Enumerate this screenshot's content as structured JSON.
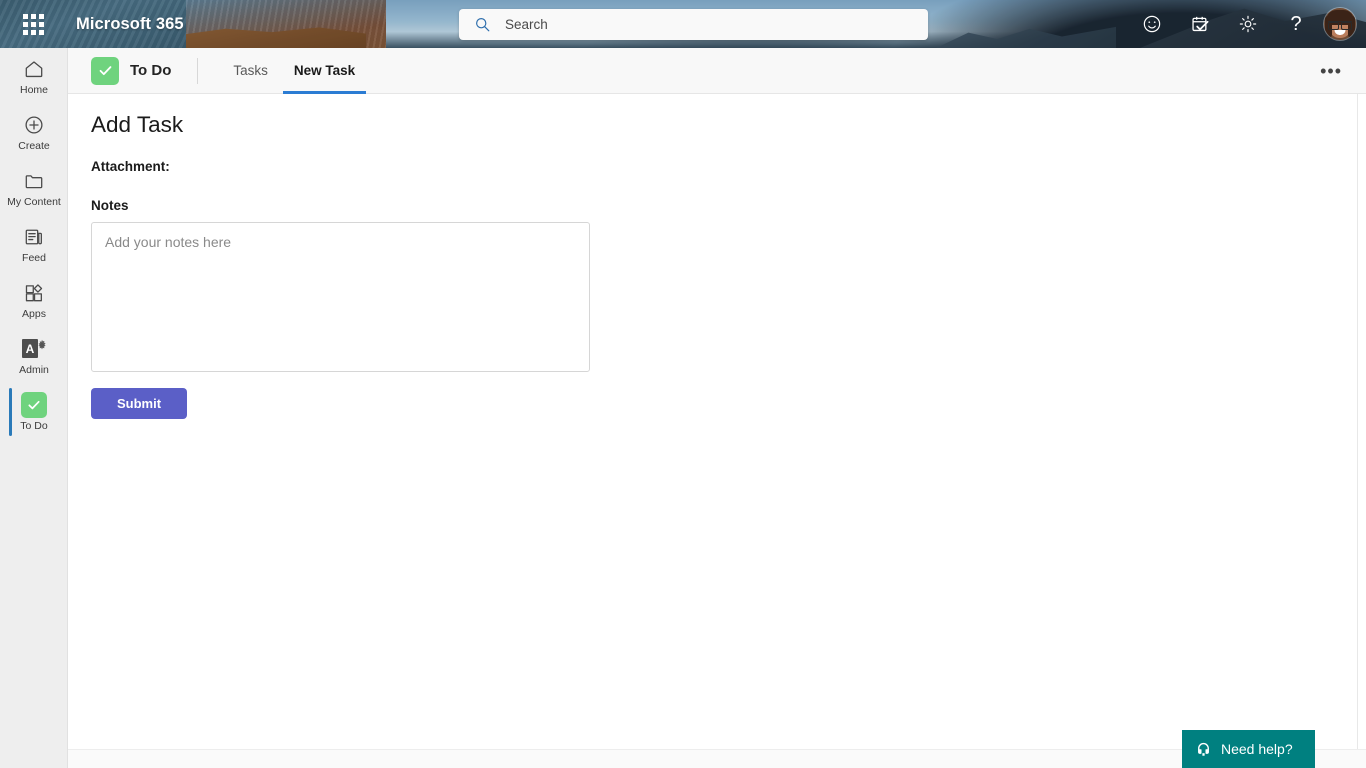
{
  "suite_header": {
    "waffle_icon": "app-launcher-grid-icon",
    "brand": "Microsoft 365",
    "search": {
      "placeholder": "Search",
      "value": "",
      "icon": "search-icon"
    },
    "actions": [
      {
        "name": "feedback-smiley-icon",
        "tooltip": "Feedback"
      },
      {
        "name": "calendar-check-icon",
        "tooltip": "Tasks"
      },
      {
        "name": "gear-icon",
        "tooltip": "Settings"
      },
      {
        "name": "help-question-icon",
        "tooltip": "Help",
        "glyph": "?"
      }
    ],
    "avatar": {
      "name": "avatar",
      "alt": "Account manager for user"
    },
    "background": "mountain-landscape-photo"
  },
  "left_rail": {
    "items": [
      {
        "label": "Home",
        "icon": "home-icon",
        "selected": false
      },
      {
        "label": "Create",
        "icon": "plus-circle-icon",
        "selected": false
      },
      {
        "label": "My Content",
        "icon": "folder-icon",
        "selected": false
      },
      {
        "label": "Feed",
        "icon": "feed-icon",
        "selected": false
      },
      {
        "label": "Apps",
        "icon": "apps-grid-icon",
        "selected": false
      },
      {
        "label": "Admin",
        "icon": "admin-gear-icon",
        "selected": false
      },
      {
        "label": "To Do",
        "icon": "todo-check-icon",
        "selected": true
      }
    ]
  },
  "app_bar": {
    "app_name": "To Do",
    "app_icon": "todo-check-icon",
    "tabs": [
      {
        "label": "Tasks",
        "active": false
      },
      {
        "label": "New Task",
        "active": true
      }
    ],
    "overflow_label": "•••",
    "overflow_icon": "more-horizontal-icon"
  },
  "main": {
    "title": "Add Task",
    "attachment_label": "Attachment:",
    "notes_label": "Notes",
    "notes": {
      "placeholder": "Add your notes here",
      "value": ""
    },
    "submit_label": "Submit"
  },
  "need_help": {
    "label": "Need help?",
    "icon": "headset-icon"
  },
  "colors": {
    "accent_blue": "#2b7cd3",
    "todo_green": "#6fd37e",
    "submit_purple": "#5b5fc7",
    "help_teal": "#008080",
    "rail_bg": "#eeeeee",
    "app_bar_bg": "#f8f8f8"
  }
}
